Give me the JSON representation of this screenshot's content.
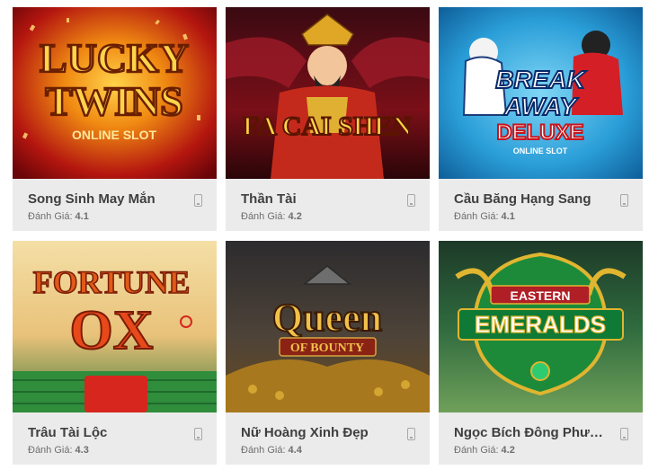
{
  "rating_label": "Đánh Giá:",
  "games": [
    {
      "name": "Song Sinh May Mắn",
      "rating": "4.1",
      "art": {
        "line1": "LUCKY",
        "line2": "TWINS",
        "line3": "ONLINE SLOT"
      }
    },
    {
      "name": "Thần Tài",
      "rating": "4.2",
      "art": {
        "line1": "FA CAI SHEN"
      }
    },
    {
      "name": "Cầu Băng Hạng Sang",
      "rating": "4.1",
      "art": {
        "line1": "BREAK",
        "line2": "AWAY",
        "line3": "DELUXE",
        "line4": "ONLINE SLOT"
      }
    },
    {
      "name": "Trâu Tài Lộc",
      "rating": "4.3",
      "art": {
        "line1": "FORTUNE",
        "line2": "OX"
      }
    },
    {
      "name": "Nữ Hoàng Xinh Đẹp",
      "rating": "4.4",
      "art": {
        "line1": "Queen",
        "line2": "OF BOUNTY"
      }
    },
    {
      "name": "Ngọc Bích Đông Phương",
      "rating": "4.2",
      "art": {
        "line1": "EASTERN",
        "line2": "EMERALDS"
      }
    }
  ],
  "icons": {
    "device": "mobile-device-icon"
  },
  "colors": {
    "card_bg": "#ebebeb",
    "title": "#3f3f3f",
    "rating": "#6e6e6e"
  }
}
